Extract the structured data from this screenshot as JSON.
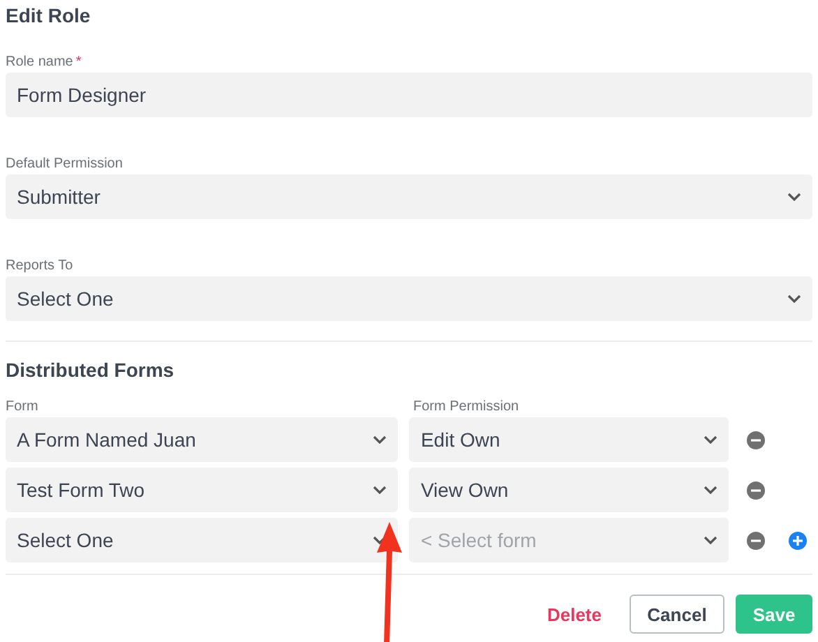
{
  "title": "Edit Role",
  "fields": [
    {
      "kind": "text",
      "label": "Role name",
      "required_mark": "*",
      "value": "Form Designer"
    },
    {
      "kind": "select",
      "label": "Default Permission",
      "value": "Submitter"
    },
    {
      "kind": "select",
      "label": "Reports To",
      "value": "Select One"
    }
  ],
  "distributed_forms": {
    "title": "Distributed Forms",
    "columns": [
      "Form",
      "Form Permission"
    ],
    "rows": [
      {
        "form": "A Form Named Juan",
        "permission": "Edit Own",
        "permission_disabled": false,
        "can_add": false
      },
      {
        "form": "Test Form Two",
        "permission": "View Own",
        "permission_disabled": false,
        "can_add": false
      },
      {
        "form": "Select One",
        "permission": "< Select form",
        "permission_disabled": true,
        "can_add": true
      }
    ]
  },
  "buttons": {
    "delete": "Delete",
    "cancel": "Cancel",
    "save": "Save"
  },
  "annotation": {
    "kind": "arrow"
  }
}
